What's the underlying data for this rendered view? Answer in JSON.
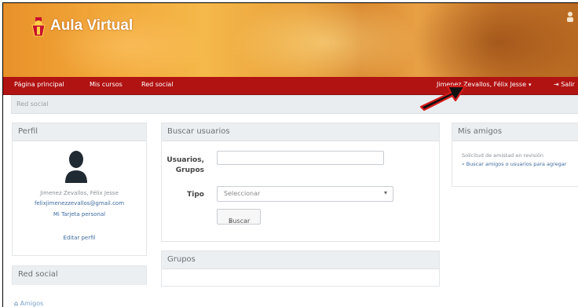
{
  "app": {
    "title": "Aula Virtual"
  },
  "colors": {
    "brand_orange": "#f2a83a",
    "navbar_red": "#b11212",
    "panel_header": "#eceff1",
    "link_blue": "#3e6c9e"
  },
  "navbar": {
    "left_items": [
      "Página principal",
      "Mis cursos",
      "Red social"
    ],
    "user_menu_label": "Jimenez Zevallos, Félix Jesse",
    "logout_label": "Salir"
  },
  "breadcrumb": {
    "current": "Red social"
  },
  "profile": {
    "title": "Perfil",
    "name": "Jimenez Zevallos, Félix Jesse",
    "email": "felixjimenezzevallos@gmail.com",
    "card_link": "Mi Tarjeta personal",
    "edit_link": "Editar perfil"
  },
  "search": {
    "title": "Buscar usuarios",
    "users_groups_label_line1": "Usuarios,",
    "users_groups_label_line2": "Grupos",
    "users_input_value": "",
    "type_label": "Tipo",
    "type_select_value": "Seleccionar",
    "search_button": "Buscar"
  },
  "groups": {
    "title": "Grupos"
  },
  "friends": {
    "title": "Mis amigos",
    "line1": "Solicitud de amistad en revisión",
    "line2": "Buscar amigos o usuarios para agregar"
  },
  "social_sidebar": {
    "title": "Red social",
    "first_item": "Amigos"
  },
  "icons": [
    "logo-crest-icon",
    "user-silhouette-icon",
    "search-icon",
    "caret-down-icon",
    "logout-icon",
    "friends-icon",
    "pointer-arrow-icon"
  ]
}
